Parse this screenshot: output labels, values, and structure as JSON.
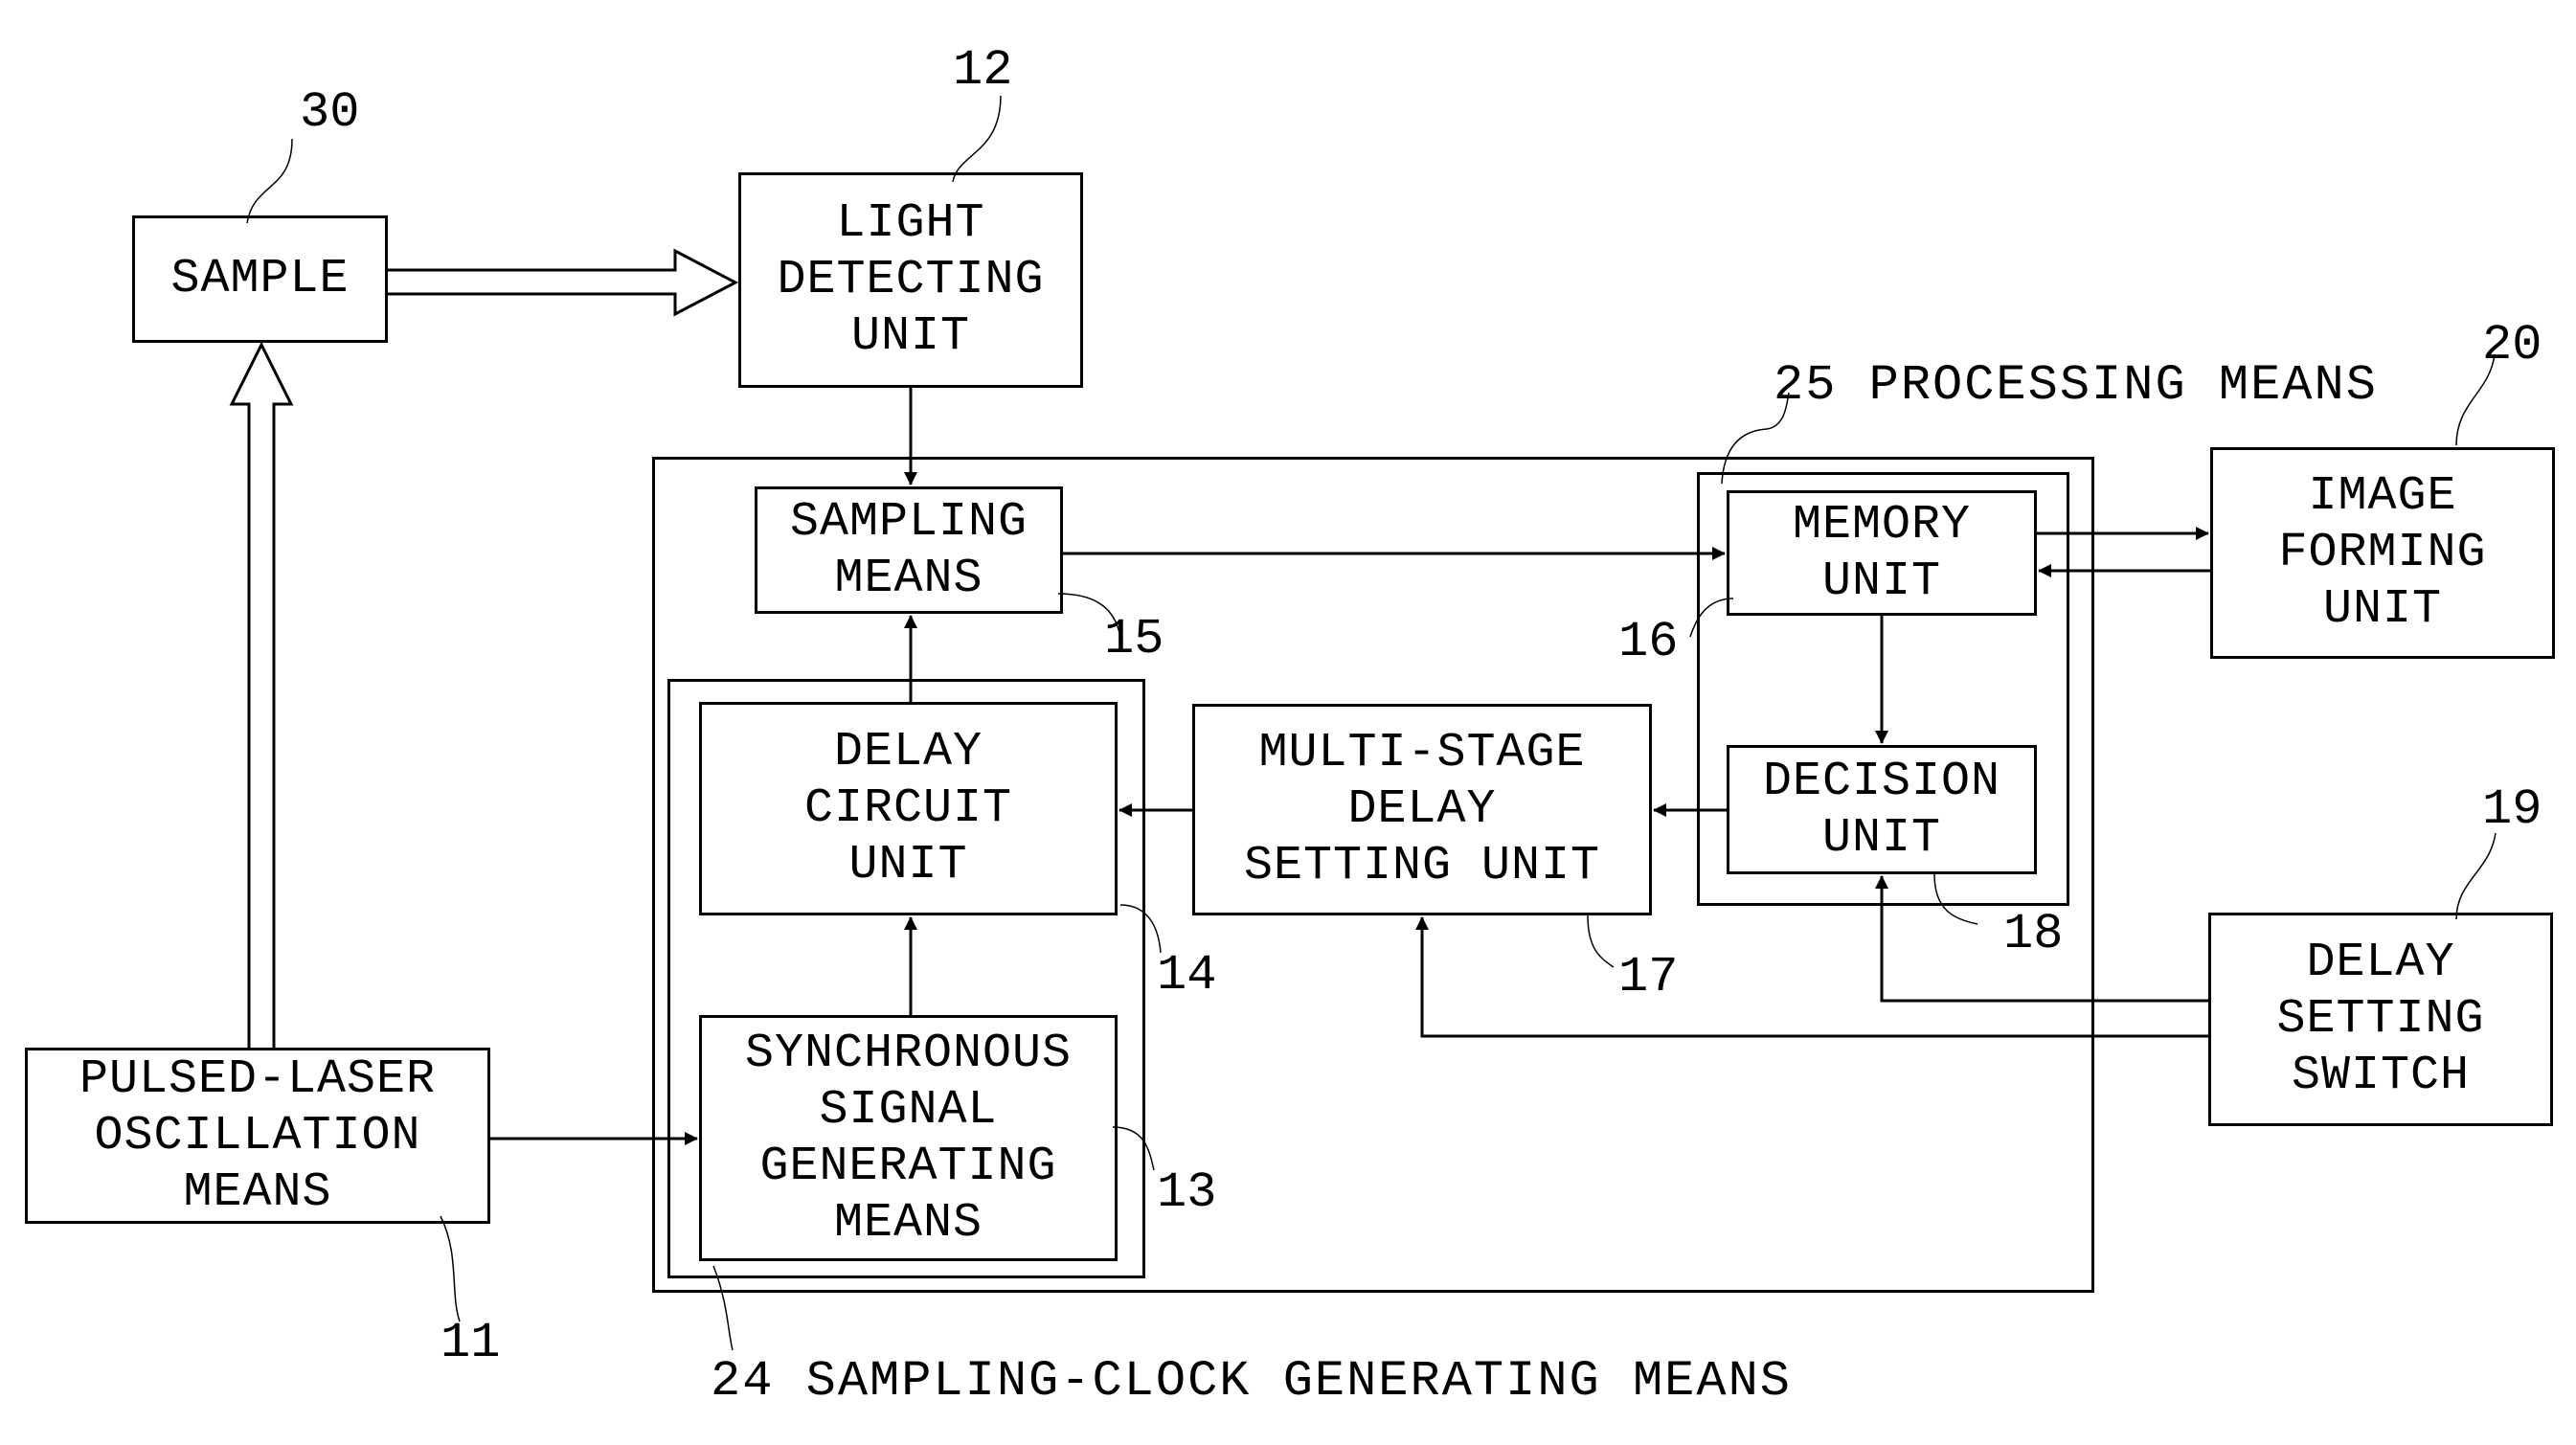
{
  "diagram": {
    "blocks": {
      "sample": {
        "ref": "30",
        "lines": [
          "SAMPLE"
        ]
      },
      "light_detecting_unit": {
        "ref": "12",
        "lines": [
          "LIGHT",
          "DETECTING",
          "UNIT"
        ]
      },
      "sampling_means": {
        "ref": "15",
        "lines": [
          "SAMPLING",
          "MEANS"
        ]
      },
      "memory_unit": {
        "ref": "16",
        "lines": [
          "MEMORY",
          "UNIT"
        ]
      },
      "decision_unit": {
        "ref": "18",
        "lines": [
          "DECISION",
          "UNIT"
        ]
      },
      "image_forming_unit": {
        "ref": "20",
        "lines": [
          "IMAGE",
          "FORMING",
          "UNIT"
        ]
      },
      "delay_circuit_unit": {
        "ref": "14",
        "lines": [
          "DELAY",
          "CIRCUIT",
          "UNIT"
        ]
      },
      "multi_stage_delay_setting_unit": {
        "ref": "17",
        "lines": [
          "MULTI-STAGE",
          "DELAY",
          "SETTING UNIT"
        ]
      },
      "synchronous_signal_generating_means": {
        "ref": "13",
        "lines": [
          "SYNCHRONOUS",
          "SIGNAL",
          "GENERATING",
          "MEANS"
        ]
      },
      "delay_setting_switch": {
        "ref": "19",
        "lines": [
          "DELAY",
          "SETTING",
          "SWITCH"
        ]
      },
      "pulsed_laser_oscillation_means": {
        "ref": "11",
        "lines": [
          "PULSED-LASER",
          "OSCILLATION",
          "MEANS"
        ]
      }
    },
    "groups": {
      "processing_means": {
        "ref": "25",
        "label": "25 PROCESSING MEANS"
      },
      "sampling_clock_generating_means": {
        "ref": "24",
        "label": "24 SAMPLING-CLOCK GENERATING MEANS"
      }
    },
    "connections": [
      {
        "from": "sample",
        "to": "light_detecting_unit",
        "style": "hollow-double"
      },
      {
        "from": "pulsed_laser_oscillation_means",
        "to": "sample",
        "style": "hollow-double"
      },
      {
        "from": "light_detecting_unit",
        "to": "sampling_means",
        "style": "arrow"
      },
      {
        "from": "sampling_means",
        "to": "memory_unit",
        "style": "arrow"
      },
      {
        "from": "memory_unit",
        "to": "image_forming_unit",
        "style": "arrow"
      },
      {
        "from": "image_forming_unit",
        "to": "memory_unit",
        "style": "arrow"
      },
      {
        "from": "memory_unit",
        "to": "decision_unit",
        "style": "arrow"
      },
      {
        "from": "decision_unit",
        "to": "multi_stage_delay_setting_unit",
        "style": "arrow"
      },
      {
        "from": "multi_stage_delay_setting_unit",
        "to": "delay_circuit_unit",
        "style": "arrow"
      },
      {
        "from": "delay_circuit_unit",
        "to": "sampling_means",
        "style": "arrow"
      },
      {
        "from": "synchronous_signal_generating_means",
        "to": "delay_circuit_unit",
        "style": "arrow"
      },
      {
        "from": "pulsed_laser_oscillation_means",
        "to": "synchronous_signal_generating_means",
        "style": "arrow"
      },
      {
        "from": "delay_setting_switch",
        "to": "decision_unit",
        "style": "arrow"
      },
      {
        "from": "delay_setting_switch",
        "to": "multi_stage_delay_setting_unit",
        "style": "arrow"
      }
    ]
  }
}
